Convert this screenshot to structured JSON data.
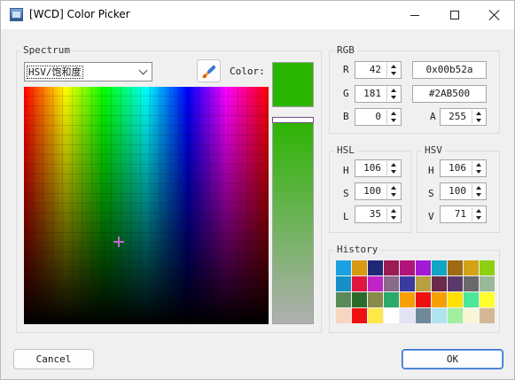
{
  "window": {
    "title": "[WCD] Color Picker"
  },
  "spectrum": {
    "group_label": "Spectrum",
    "mode_selected": "HSV/饱和度",
    "color_label": "Color:",
    "crosshair_color": "#c06ad0"
  },
  "current_color": "#2AB500",
  "slider_top_color": "#2AB500",
  "slider_bottom_color": "#b0b0b0",
  "rgb": {
    "group_label": "RGB",
    "r_label": "R",
    "r": "42",
    "g_label": "G",
    "g": "181",
    "b_label": "B",
    "b": "0",
    "a_label": "A",
    "a": "255",
    "hex_dword": "0x00b52a",
    "hex_html": "#2AB500"
  },
  "hsl": {
    "group_label": "HSL",
    "h_label": "H",
    "h": "106",
    "s_label": "S",
    "s": "100",
    "l_label": "L",
    "l": "35"
  },
  "hsv": {
    "group_label": "HSV",
    "h_label": "H",
    "h": "106",
    "s_label": "S",
    "s": "100",
    "v_label": "V",
    "v": "71"
  },
  "history": {
    "group_label": "History",
    "swatches": [
      "#1ba1e2",
      "#d79a12",
      "#1e2a78",
      "#9b1b55",
      "#b0157a",
      "#a31ad6",
      "#10a6c4",
      "#a06a12",
      "#d4a215",
      "#8cd010",
      "#1690c6",
      "#e0163e",
      "#c023c7",
      "#8a6a8a",
      "#3a3aa0",
      "#b8a040",
      "#6a2a4a",
      "#5a3a6a",
      "#6a6a6a",
      "#9ab89a",
      "#5a8a5a",
      "#2a6a2a",
      "#8a8a4a",
      "#2aaa6a",
      "#f5a000",
      "#ee1111",
      "#f5a000",
      "#ffe000",
      "#4ae89a",
      "#ffff30",
      "#f7d5c0",
      "#ee1111",
      "#ffe84a",
      "#ffffff",
      "#e3e3f5",
      "#6e8a9a",
      "#b0e4ef",
      "#a0f0a0",
      "#f7f7d8",
      "#d4b896"
    ]
  },
  "buttons": {
    "cancel": "Cancel",
    "ok": "OK"
  }
}
